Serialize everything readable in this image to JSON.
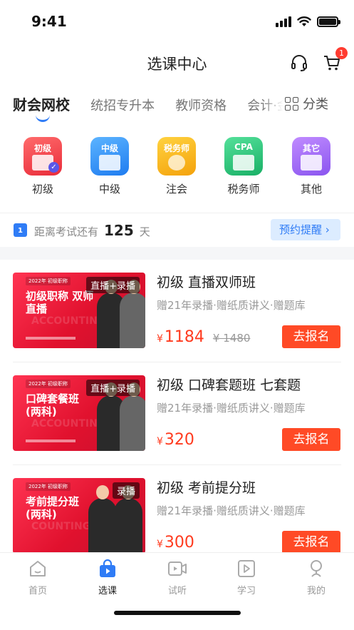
{
  "status": {
    "time": "9:41"
  },
  "header": {
    "title": "选课中心",
    "cart_badge": "1"
  },
  "tabs": [
    {
      "label": "财会网校",
      "active": true
    },
    {
      "label": "统招专升本"
    },
    {
      "label": "教师资格"
    },
    {
      "label": "会计·金"
    }
  ],
  "category_button": {
    "label": "分类"
  },
  "categories": [
    {
      "tile": "初级",
      "label": "初级",
      "color": "#f0403f"
    },
    {
      "tile": "中级",
      "label": "中级",
      "color": "#2f8bf6"
    },
    {
      "tile": "税务师",
      "label": "注会",
      "color": "#f7b515"
    },
    {
      "tile": "CPA",
      "label": "税务师",
      "color": "#2dc57a"
    },
    {
      "tile": "其它",
      "label": "其他",
      "color": "#9b6bf0"
    }
  ],
  "countdown": {
    "calendar_day": "1",
    "prefix": "距离考试还有",
    "days": "125",
    "suffix": "天",
    "remind_label": "预约提醒 ›"
  },
  "courses": [
    {
      "thumb_year": "2022年 初级职称",
      "thumb_title": "初级职称 双师直播",
      "thumb_watermark": "ACCOUNTING",
      "tag": "直播+录播",
      "title": "初级 直播双师班",
      "desc": "赠21年录播·赠纸质讲义·赠题库",
      "currency": "¥",
      "price": "1184",
      "original_price": "¥ 1480",
      "button": "去报名"
    },
    {
      "thumb_year": "2022年 初级职称",
      "thumb_title": "口碑套餐班 (两科)",
      "thumb_watermark": "ACCOUNTING",
      "tag": "直播+录播",
      "title": "初级 口碑套题班 七套题",
      "desc": "赠21年录播·赠纸质讲义·赠题库",
      "currency": "¥",
      "price": "320",
      "original_price": "",
      "button": "去报名"
    },
    {
      "thumb_year": "2022年 初级职称",
      "thumb_title": "考前提分班 (两科)",
      "thumb_watermark": "COUNTING",
      "tag": "录播",
      "title": "初级 考前提分班",
      "desc": "赠21年录播·赠纸质讲义·赠题库",
      "currency": "¥",
      "price": "300",
      "original_price": "",
      "button": "去报名"
    }
  ],
  "tabbar": [
    {
      "label": "首页",
      "icon": "home-icon"
    },
    {
      "label": "选课",
      "icon": "shopping-bag-icon",
      "active": true
    },
    {
      "label": "试听",
      "icon": "video-icon"
    },
    {
      "label": "学习",
      "icon": "play-icon"
    },
    {
      "label": "我的",
      "icon": "profile-icon"
    }
  ],
  "colors": {
    "accent": "#2f7cf6",
    "price": "#ff3b1f",
    "button": "#ff4a26"
  }
}
